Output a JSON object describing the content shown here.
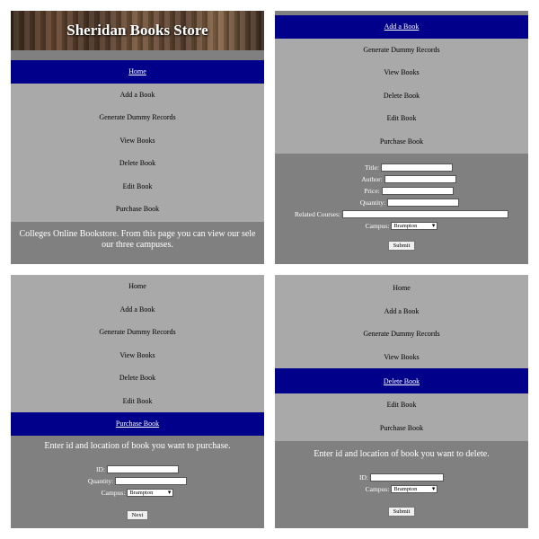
{
  "panel1": {
    "banner_title": "Sheridan Books Store",
    "nav": [
      "Home",
      "Add a Book",
      "Generate Dummy Records",
      "View Books",
      "Delete Book",
      "Edit Book",
      "Purchase Book"
    ],
    "active_index": 0,
    "intro_line1": "Colleges Online Bookstore. From this page you can view our sele",
    "intro_line2": "our three campuses."
  },
  "panel2": {
    "nav": [
      "Add a Book",
      "Generate Dummy Records",
      "View Books",
      "Delete Book",
      "Edit Book",
      "Purchase Book"
    ],
    "active_index": 0,
    "form": {
      "title_label": "Title:",
      "author_label": "Author:",
      "price_label": "Price:",
      "quantity_label": "Quantity:",
      "related_courses_label": "Related Courses:",
      "campus_label": "Campus:",
      "campus_value": "Brampton",
      "submit_label": "Submit"
    }
  },
  "panel3": {
    "nav": [
      "Home",
      "Add a Book",
      "Generate Dummy Records",
      "View Books",
      "Delete Book",
      "Edit Book",
      "Purchase Book"
    ],
    "active_index": 6,
    "message": "Enter id and location of book you want to purchase.",
    "form": {
      "id_label": "ID:",
      "quantity_label": "Quantity:",
      "campus_label": "Campus:",
      "campus_value": "Brampton",
      "next_label": "Next"
    }
  },
  "panel4": {
    "nav": [
      "Home",
      "Add a Book",
      "Generate Dummy Records",
      "View Books",
      "Delete Book",
      "Edit Book",
      "Purchase Book"
    ],
    "active_index": 4,
    "message": "Enter id and location of book you want to delete.",
    "form": {
      "id_label": "ID:",
      "campus_label": "Campus:",
      "campus_value": "Brampton",
      "submit_label": "Submit"
    }
  },
  "colors": {
    "nav_active": "#00008b",
    "nav_bg": "#a9a9a9",
    "content_bg": "#808080"
  }
}
